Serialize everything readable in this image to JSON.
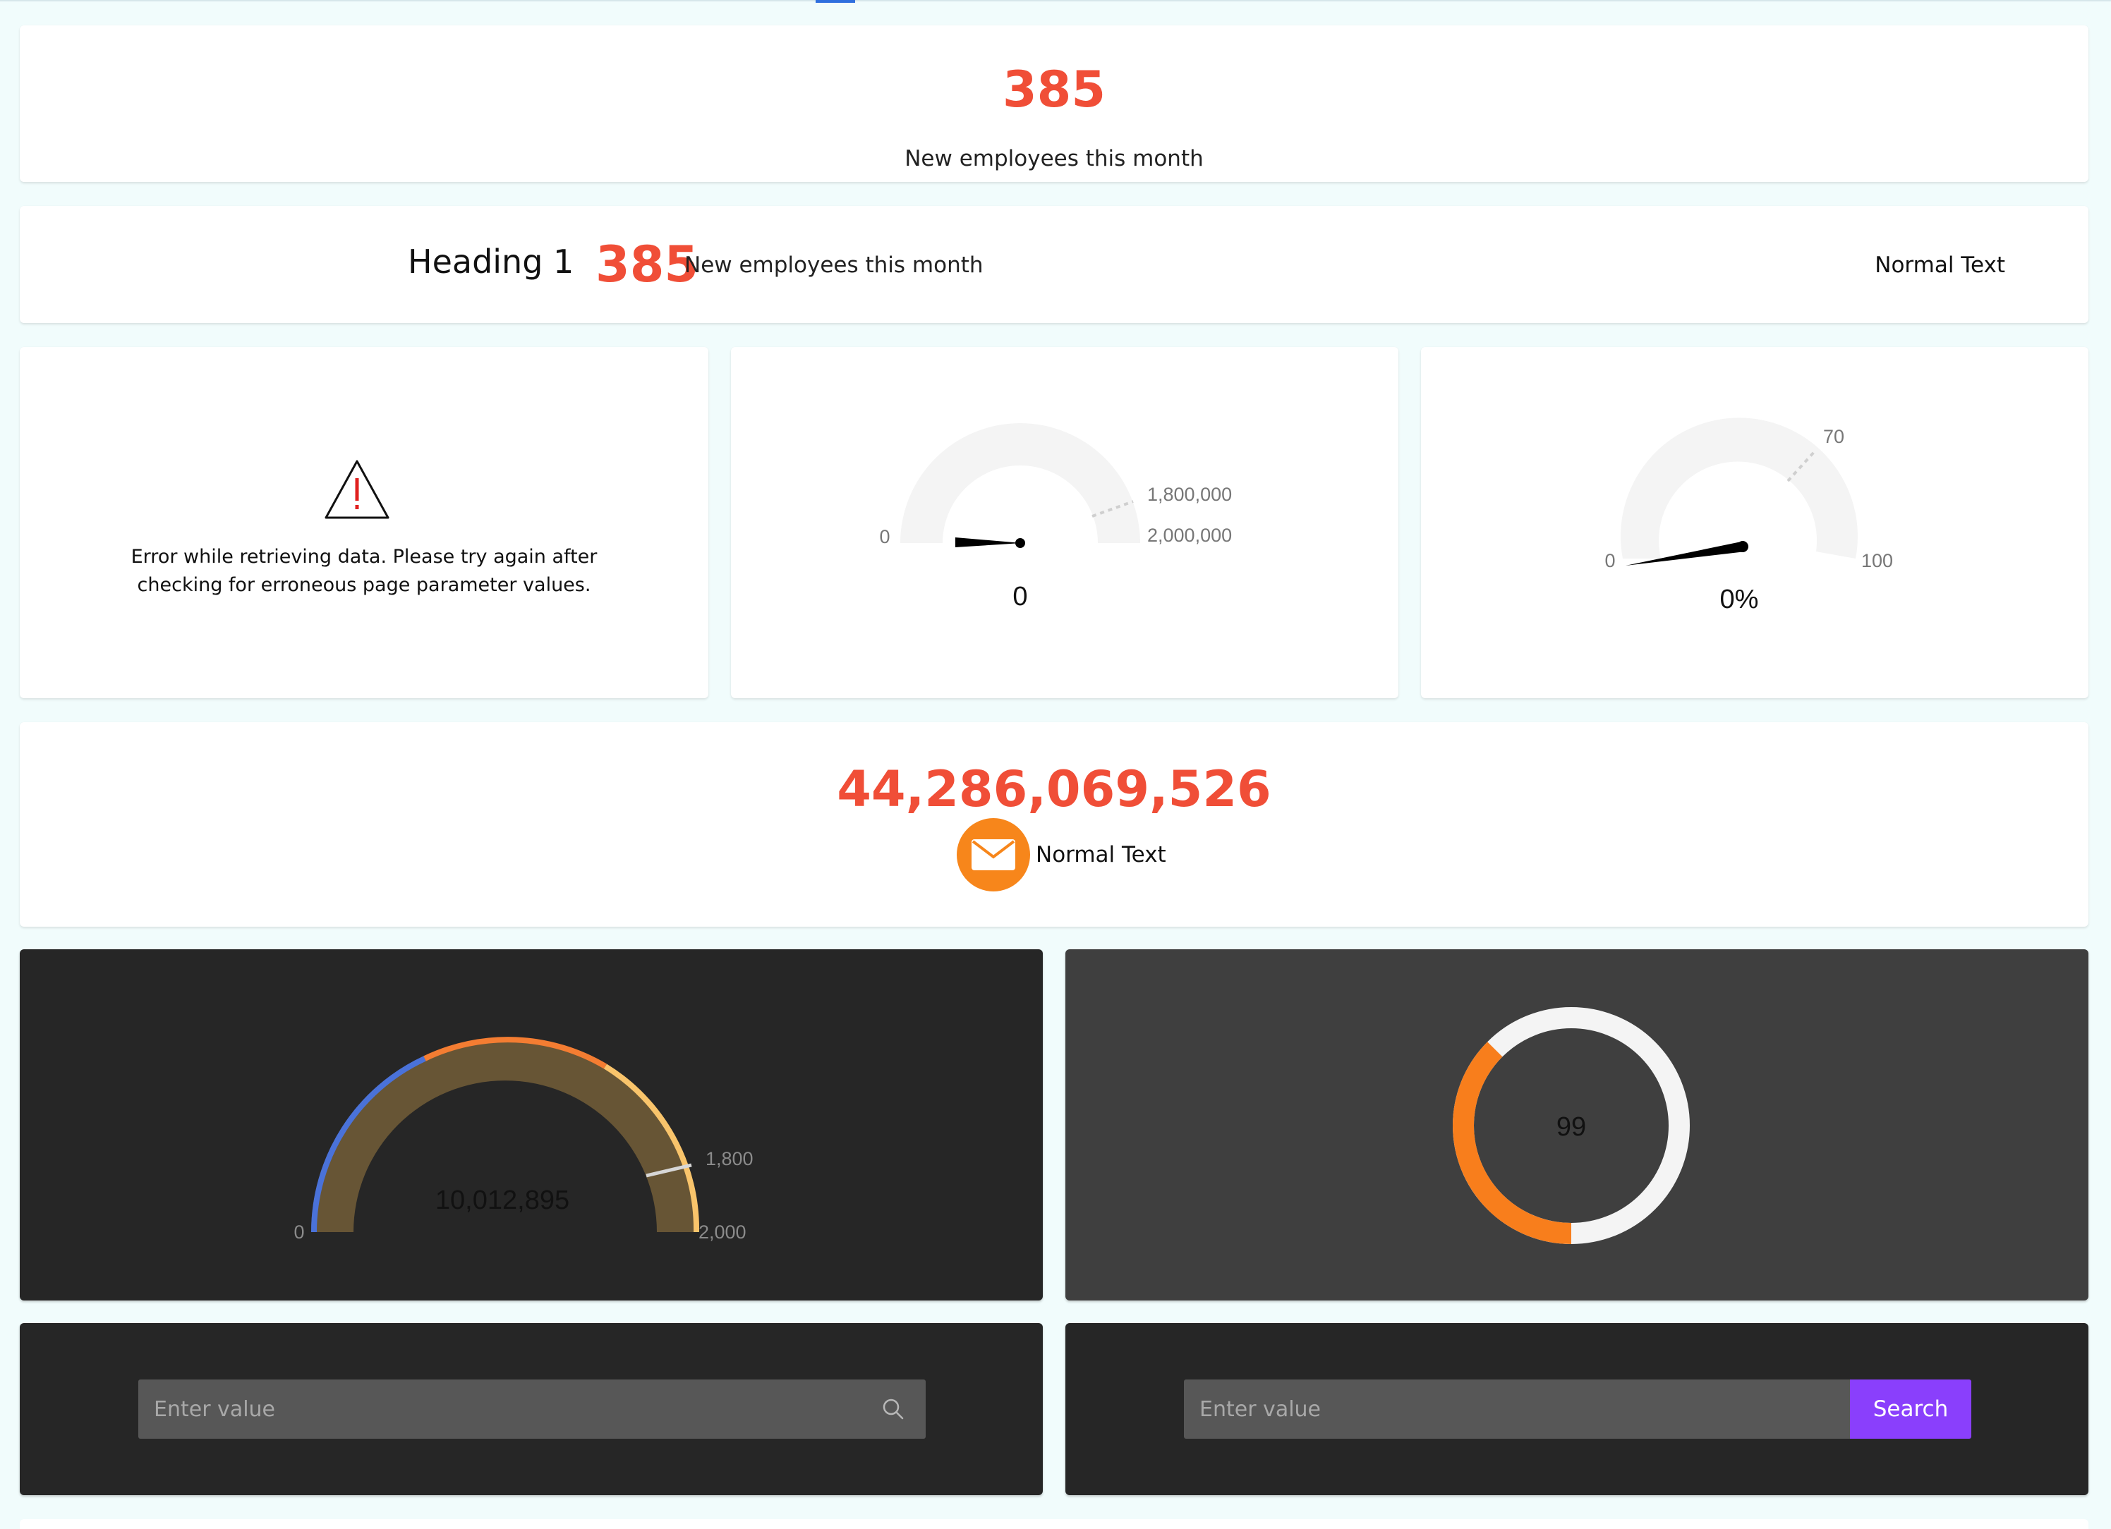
{
  "kpi_card": {
    "value": "385",
    "label": "New employees this month"
  },
  "inline_card": {
    "heading": "Heading 1",
    "value": "385",
    "label": "New employees this month",
    "right_text": "Normal Text"
  },
  "error_card": {
    "icon": "warning-triangle-icon",
    "message_line1": "Error while retrieving data. Please try again after",
    "message_line2": "checking for erroneous page parameter values."
  },
  "gauge_one": {
    "value": 0,
    "value_text": "0",
    "min_label": "0",
    "target_label": "1,800,000",
    "max_label": "2,000,000",
    "min": 0,
    "max": 2000000,
    "target": 1800000
  },
  "gauge_two": {
    "value": 0,
    "value_text": "0%",
    "min_label": "0",
    "target_label": "70",
    "max_label": "100",
    "min": 0,
    "max": 100,
    "target": 70,
    "needle_fraction": 0.1
  },
  "total_card": {
    "value": "44,286,069,526",
    "icon": "mail-icon",
    "icon_color": "#f7861b",
    "label": "Normal Text"
  },
  "dark_gauge": {
    "value_text": "10,012,895",
    "min_label": "0",
    "target_label": "1,800",
    "max_label": "2,000",
    "min": 0,
    "max": 2000,
    "target": 1800,
    "colors": {
      "low": "#4a72d9",
      "mid": "#f47d32",
      "high": "#f9c46b",
      "track": "#675535"
    }
  },
  "ring_gauge": {
    "value_text": "99",
    "filled_fraction": 0.375,
    "colors": {
      "fill": "#f87e1c",
      "track": "#f4f4f4"
    }
  },
  "search_one": {
    "placeholder": "Enter value",
    "icon": "search-icon"
  },
  "search_two": {
    "placeholder": "Enter value",
    "button_label": "Search",
    "button_color": "#8a3ffc"
  },
  "colors": {
    "accent_red": "#f04e37",
    "page_bg": "#f1fcfc"
  }
}
